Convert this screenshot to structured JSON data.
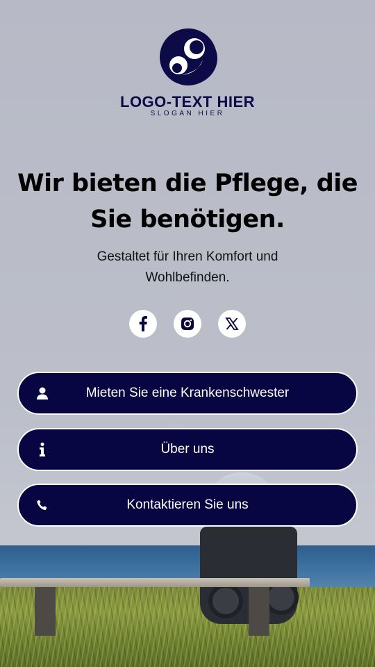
{
  "logo": {
    "title": "LOGO-TEXT HIER",
    "slogan": "SLOGAN HIER",
    "brand_color": "#0c0a47"
  },
  "hero": {
    "headline": "Wir bieten die Pflege, die Sie benötigen.",
    "subline": "Gestaltet für Ihren Komfort und Wohlbefinden."
  },
  "socials": [
    {
      "name": "facebook",
      "icon": "facebook-icon"
    },
    {
      "name": "instagram",
      "icon": "instagram-icon"
    },
    {
      "name": "x",
      "icon": "x-icon"
    }
  ],
  "buttons": [
    {
      "label": "Mieten Sie eine Krankenschwester",
      "icon": "user-icon"
    },
    {
      "label": "Über uns",
      "icon": "info-icon"
    },
    {
      "label": "Kontaktieren Sie uns",
      "icon": "phone-icon"
    }
  ],
  "colors": {
    "button_bg": "#070642",
    "button_border": "#ffffff",
    "background": "#b9bcc8"
  }
}
